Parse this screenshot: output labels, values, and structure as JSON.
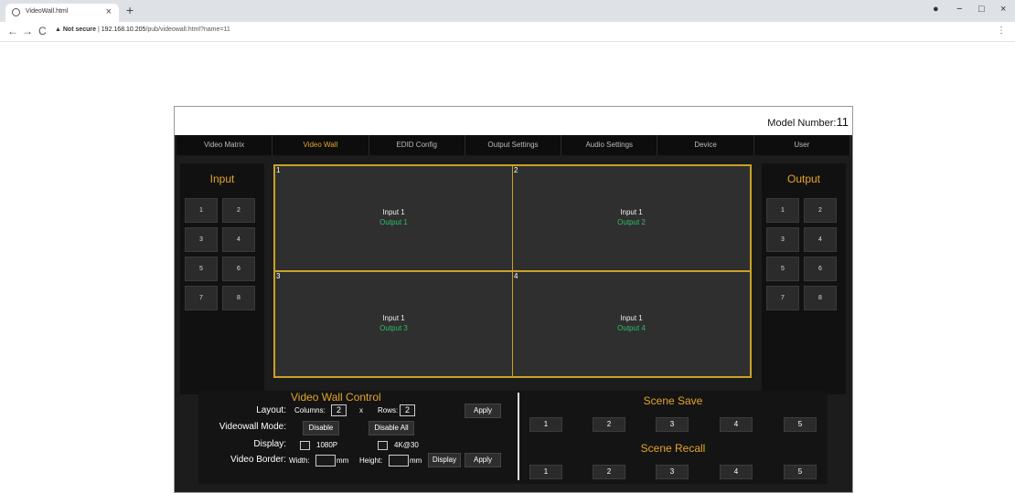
{
  "browser": {
    "tab_title": "VideoWall.html",
    "tab_close": "×",
    "new_tab": "+",
    "back": "←",
    "forward": "→",
    "reload": "C",
    "security_label": "▲ Not secure",
    "url_host": "192.168.10.205",
    "url_path": "/pub/videowall.html?name=11",
    "menu": "⋮",
    "window_controls": [
      "−",
      "□",
      "×"
    ]
  },
  "header": {
    "model_label": "Model Number:",
    "model_number": "11"
  },
  "nav": {
    "items": [
      "Video Matrix",
      "Video Wall",
      "EDID Config",
      "Output Settings",
      "Audio Settings",
      "Device",
      "User"
    ],
    "active": "Video Wall"
  },
  "input": {
    "title": "Input",
    "buttons": [
      "1",
      "2",
      "3",
      "4",
      "5",
      "6",
      "7",
      "8"
    ]
  },
  "output": {
    "title": "Output",
    "buttons": [
      "1",
      "2",
      "3",
      "4",
      "5",
      "6",
      "7",
      "8"
    ]
  },
  "wall": {
    "cells": [
      {
        "number": "1",
        "input": "Input 1",
        "output": "Output 1"
      },
      {
        "number": "2",
        "input": "Input 1",
        "output": "Output 2"
      },
      {
        "number": "3",
        "input": "Input 1",
        "output": "Output 3"
      },
      {
        "number": "4",
        "input": "Input 1",
        "output": "Output 4"
      }
    ]
  },
  "control": {
    "title": "Video Wall Control",
    "layout_label": "Layout:",
    "columns_label": "Columns:",
    "columns_value": "2",
    "x_label": "x",
    "rows_label": "Rows:",
    "rows_value": "2",
    "apply_label": "Apply",
    "mode_label": "Videowall Mode:",
    "disable_label": "Disable",
    "disable_all_label": "Disable All",
    "display_label": "Display:",
    "opt_1080p": "1080P",
    "opt_4k": "4K@30",
    "border_label": "Video Border:",
    "width_label": "Width:",
    "mm_label": "mm",
    "height_label": "Height:",
    "display_btn_label": "Display",
    "apply2_label": "Apply"
  },
  "scenes": {
    "save_title": "Scene Save",
    "recall_title": "Scene Recall",
    "save_buttons": [
      "1",
      "2",
      "3",
      "4",
      "5"
    ],
    "recall_buttons": [
      "1",
      "2",
      "3",
      "4",
      "5"
    ]
  }
}
